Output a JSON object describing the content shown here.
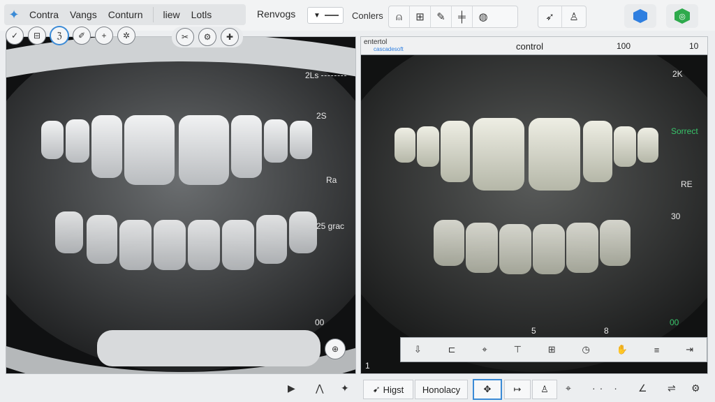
{
  "menu": {
    "items": [
      "Contra",
      "Vangs",
      "Conturn",
      "liew",
      "Lotls"
    ],
    "extra": "Renvogs",
    "conters": "Conlers"
  },
  "overlay_left": {
    "labels": [
      "2Ls",
      "2S",
      "Ra",
      "25 grac",
      "00"
    ]
  },
  "overlay_right": {
    "control": "control",
    "ruler_values": [
      "100",
      "10"
    ],
    "corner_text": "entertol",
    "corner_sub": "cascadesoft",
    "labels": [
      "2K",
      "Sorrect",
      "RE",
      "30",
      "00"
    ],
    "bottom_marks": [
      "5",
      "8"
    ],
    "bottom_left": "1"
  },
  "status": {
    "higst": "Higst",
    "honolacy": "Honolacy"
  },
  "colors": {
    "accent": "#3a8ad6",
    "hex_blue": "#2f7fe0",
    "hex_green": "#2eaa4c"
  }
}
